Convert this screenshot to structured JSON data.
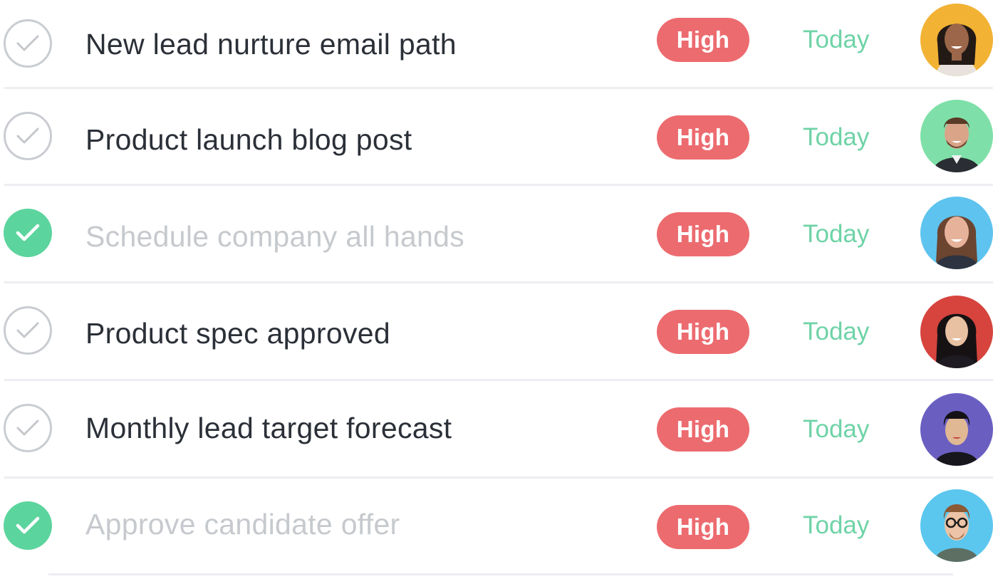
{
  "colors": {
    "priority_badge": "#ec6b6f",
    "due_date_text": "#6fd3a7",
    "complete_check": "#5cd49d",
    "incomplete_check_border": "#c9ccd1",
    "title_text": "#2b3038",
    "completed_title_text": "#c6c9cd"
  },
  "tasks": [
    {
      "title": "New lead nurture email path",
      "completed": false,
      "priority": "High",
      "due": "Today",
      "avatar_color": "#f2b234",
      "check_icon": "checkmark-icon"
    },
    {
      "title": "Product launch blog post",
      "completed": false,
      "priority": "High",
      "due": "Today",
      "avatar_color": "#7ee0a8",
      "check_icon": "checkmark-icon"
    },
    {
      "title": "Schedule company all hands",
      "completed": true,
      "priority": "High",
      "due": "Today",
      "avatar_color": "#5ec3ee",
      "check_icon": "checkmark-icon"
    },
    {
      "title": "Product spec approved",
      "completed": false,
      "priority": "High",
      "due": "Today",
      "avatar_color": "#d6443d",
      "check_icon": "checkmark-icon"
    },
    {
      "title": "Monthly lead target forecast",
      "completed": false,
      "priority": "High",
      "due": "Today",
      "avatar_color": "#6a5fc1",
      "check_icon": "checkmark-icon"
    },
    {
      "title": "Approve candidate offer",
      "completed": true,
      "priority": "High",
      "due": "Today",
      "avatar_color": "#5bc7ef",
      "check_icon": "checkmark-icon"
    }
  ]
}
